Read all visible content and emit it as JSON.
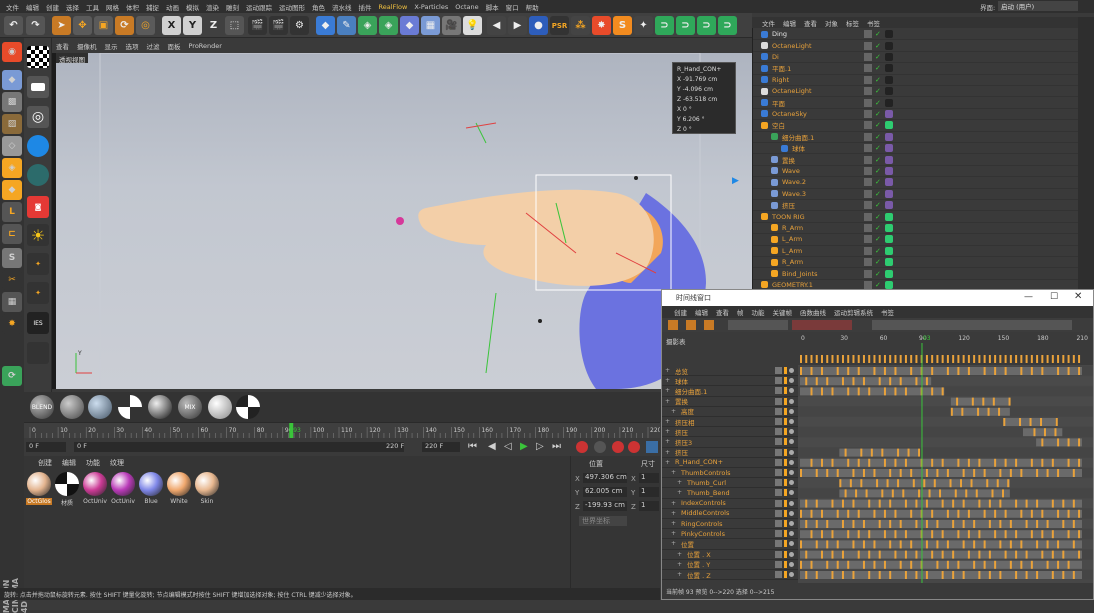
{
  "menubar": {
    "items": [
      "文件",
      "编辑",
      "创建",
      "选择",
      "工具",
      "网格",
      "体积",
      "捕捉",
      "动画",
      "模拟",
      "渲染",
      "雕刻",
      "运动跟踪",
      "运动图形",
      "角色",
      "流水线",
      "插件",
      "RealFlow",
      "X-Particles",
      "Octane",
      "脚本",
      "窗口",
      "帮助"
    ],
    "layout_label": "界面:",
    "layout_value": "启动 (用户)"
  },
  "viewport": {
    "menu": [
      "查看",
      "摄像机",
      "显示",
      "选项",
      "过滤",
      "面板",
      "ProRender"
    ],
    "label": "透视视图",
    "coords": {
      "title": "R_Hand_CON+",
      "x": "X  -91.769 cm",
      "y": "Y  -4.096 cm",
      "z": "Z  -63.518 cm",
      "rx": "X  0 °",
      "ry": "Y  6.206 °",
      "rz": "Z  0 °"
    }
  },
  "material_bar": {
    "items": [
      "BLEND",
      "",
      "",
      "",
      "",
      "MIX",
      "",
      ""
    ]
  },
  "timeline": {
    "ticks": [
      "0",
      "10",
      "20",
      "30",
      "40",
      "50",
      "60",
      "70",
      "80",
      "90",
      "93",
      "100",
      "110",
      "120",
      "130",
      "140",
      "150",
      "160",
      "170",
      "180",
      "190",
      "200",
      "210",
      "220"
    ],
    "start": "0 F",
    "end": "220 F",
    "end2": "220 F",
    "current": "0 F"
  },
  "material_manager": {
    "menu": [
      "创建",
      "编辑",
      "功能",
      "纹理"
    ],
    "materials": [
      {
        "name": "OctGlos",
        "color": "#e3b48f"
      },
      {
        "name": "材质",
        "color": "#ffffff"
      },
      {
        "name": "OctUniv",
        "color": "#cc3b96"
      },
      {
        "name": "OctUniv",
        "color": "#b93ab8"
      },
      {
        "name": "Blue",
        "color": "#7f87e8"
      },
      {
        "name": "White",
        "color": "#f0a86e"
      },
      {
        "name": "Skin",
        "color": "#e8b890"
      }
    ]
  },
  "attributes": {
    "header1": "位置",
    "header2": "尺寸",
    "x": "497.306 cm",
    "y": "62.005 cm",
    "z": "-199.93 cm",
    "sx": "1",
    "sy": "1",
    "sz": "1",
    "mode": "世界坐标",
    "apply": "应用"
  },
  "status": "旋转: 点击并拖动鼠标旋转元素. 按住 SHIFT 键量化旋转; 节点编辑模式时按住 SHIFT 键增加选择对象; 按住 CTRL 键减少选择对象。",
  "object_manager": {
    "menu": [
      "文件",
      "编辑",
      "查看",
      "对象",
      "标签",
      "书签"
    ],
    "objects": [
      {
        "name": "Ding",
        "color": "w"
      },
      {
        "name": "OctaneLight",
        "color": "o"
      },
      {
        "name": "Di",
        "color": "o"
      },
      {
        "name": "平面.1",
        "color": "o"
      },
      {
        "name": "Right",
        "color": "o"
      },
      {
        "name": "OctaneLight",
        "color": "o"
      },
      {
        "name": "平面",
        "color": "o"
      },
      {
        "name": "OctaneSky",
        "color": "o"
      },
      {
        "name": "空白",
        "color": "o"
      },
      {
        "name": "细分曲面.1",
        "color": "o"
      },
      {
        "name": "球体",
        "color": "o"
      },
      {
        "name": "置换",
        "color": "o"
      },
      {
        "name": "Wave",
        "color": "o"
      },
      {
        "name": "Wave.2",
        "color": "o"
      },
      {
        "name": "Wave.3",
        "color": "o"
      },
      {
        "name": "挤压",
        "color": "o"
      },
      {
        "name": "TOON RIG",
        "color": "o"
      },
      {
        "name": "R_Arm",
        "color": "o"
      },
      {
        "name": "L_Arm",
        "color": "o"
      },
      {
        "name": "L_Arm",
        "color": "o"
      },
      {
        "name": "R_Arm",
        "color": "o"
      },
      {
        "name": "Bind_Joints",
        "color": "o"
      },
      {
        "name": "GEOMETRY.1",
        "color": "o"
      }
    ]
  },
  "timeline_window": {
    "title": "时间线窗口",
    "menu": [
      "创建",
      "编辑",
      "查看",
      "帧",
      "功能",
      "关键帧",
      "函数曲线",
      "运动剪辑系统",
      "书签"
    ],
    "header": "摄影表",
    "ticks": [
      "0",
      "30",
      "60",
      "90",
      "93",
      "120",
      "150",
      "180",
      "210"
    ],
    "tracks": [
      "总览",
      "球体",
      "细分曲面.1",
      "置换",
      "高度",
      "挤压相",
      "挤压",
      "挤压3",
      "挤压",
      "R_Hand_CON+",
      "ThumbControls",
      "Thumb_Curl",
      "Thumb_Bend",
      "IndexControls",
      "MiddleControls",
      "RingControls",
      "PinkyControls",
      "位置",
      "位置 . X",
      "位置 . Y",
      "位置 . Z"
    ],
    "footer": "当前帧 93   预览 0-->220   选择 0-->215"
  },
  "colors": {
    "accent": "#e9a23b",
    "green": "#2ecc71",
    "panel": "#3a3a3a"
  }
}
